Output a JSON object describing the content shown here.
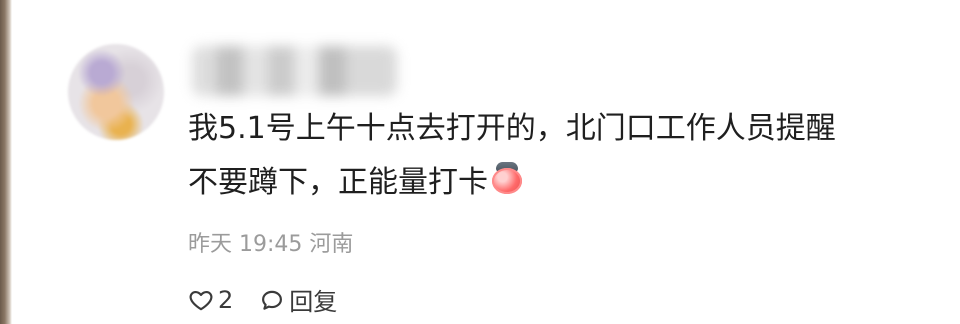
{
  "post": {
    "content_lines": [
      "我5.1号上午十点去打开的，北门口工作人员提醒",
      "不要蹲下，正能量打卡"
    ],
    "meta": "昨天 19:45 河南"
  },
  "actions": {
    "like_count": "2",
    "reply_label": "回复"
  },
  "icons": {
    "like": "heart-outline-icon",
    "reply": "speech-bubble-icon",
    "emoji": "emoji-face-icon"
  },
  "colors": {
    "text": "#1f1f1f",
    "meta": "#9b9b9b",
    "action": "#3a3a3a"
  }
}
